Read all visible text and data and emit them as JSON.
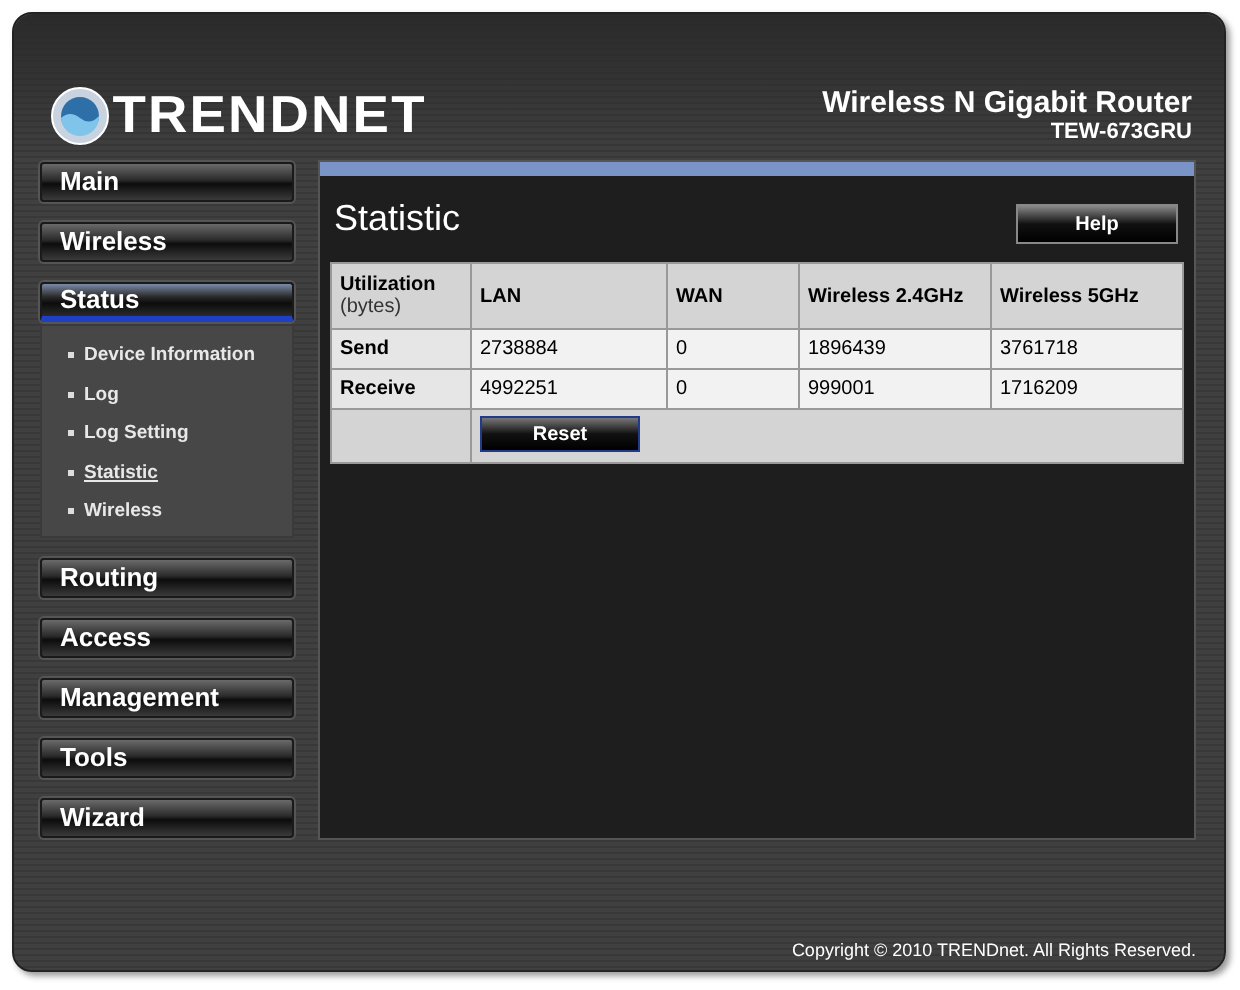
{
  "header": {
    "brand": "TRENDNET",
    "product": "Wireless N Gigabit Router",
    "model": "TEW-673GRU"
  },
  "sidebar": {
    "items": [
      {
        "label": "Main",
        "selected": false
      },
      {
        "label": "Wireless",
        "selected": false
      },
      {
        "label": "Status",
        "selected": true,
        "children": [
          {
            "label": "Device Information",
            "selected": false
          },
          {
            "label": "Log",
            "selected": false
          },
          {
            "label": "Log Setting",
            "selected": false
          },
          {
            "label": "Statistic",
            "selected": true
          },
          {
            "label": "Wireless",
            "selected": false
          }
        ]
      },
      {
        "label": "Routing",
        "selected": false
      },
      {
        "label": "Access",
        "selected": false
      },
      {
        "label": "Management",
        "selected": false
      },
      {
        "label": "Tools",
        "selected": false
      },
      {
        "label": "Wizard",
        "selected": false
      }
    ]
  },
  "content": {
    "title": "Statistic",
    "help_button": "Help",
    "table": {
      "corner": {
        "label": "Utilization",
        "unit": "(bytes)"
      },
      "columns": [
        "LAN",
        "WAN",
        "Wireless 2.4GHz",
        "Wireless 5GHz"
      ],
      "rows": [
        {
          "label": "Send",
          "values": [
            "2738884",
            "0",
            "1896439",
            "3761718"
          ]
        },
        {
          "label": "Receive",
          "values": [
            "4992251",
            "0",
            "999001",
            "1716209"
          ]
        }
      ],
      "reset_button": "Reset"
    }
  },
  "footer": {
    "copyright": "Copyright © 2010 TRENDnet. All Rights Reserved."
  }
}
